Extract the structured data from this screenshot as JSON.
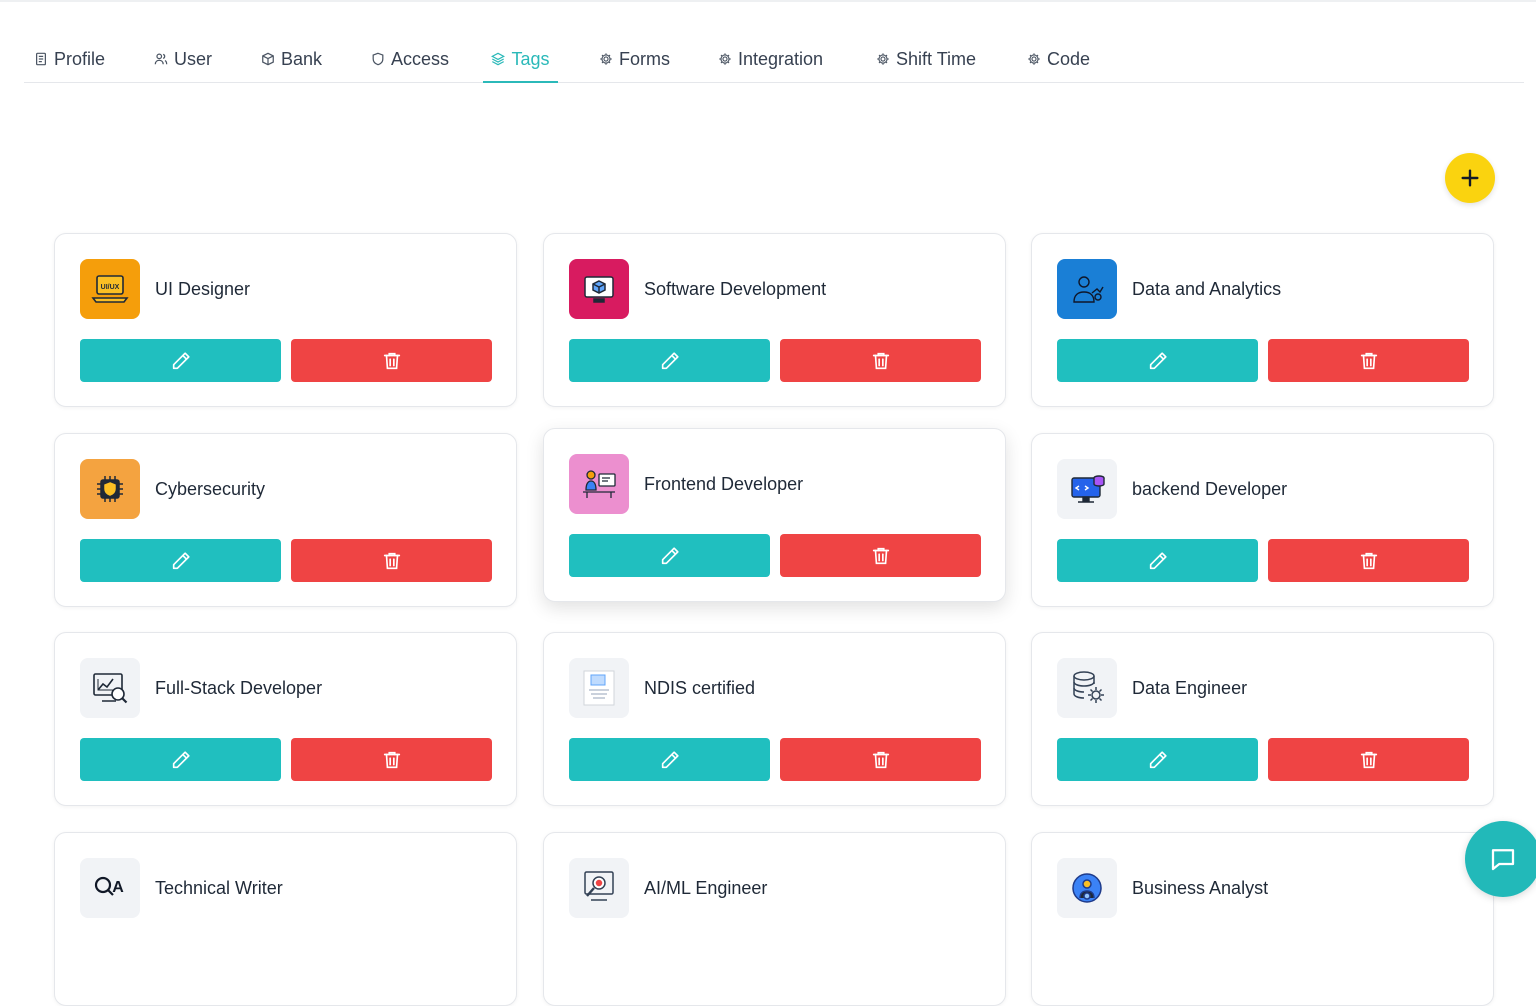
{
  "tabs": [
    {
      "label": "Profile",
      "icon": "id-card-icon"
    },
    {
      "label": "User",
      "icon": "users-icon"
    },
    {
      "label": "Bank",
      "icon": "box-icon"
    },
    {
      "label": "Access",
      "icon": "shield-icon"
    },
    {
      "label": "Tags",
      "icon": "layers-icon",
      "active": true
    },
    {
      "label": "Forms",
      "icon": "gear-icon"
    },
    {
      "label": "Integration",
      "icon": "gear-icon"
    },
    {
      "label": "Shift Time",
      "icon": "gear-icon"
    },
    {
      "label": "Code",
      "icon": "gear-icon"
    }
  ],
  "add_button_icon": "plus-icon",
  "colors": {
    "accent": "#2bb9b9",
    "edit": "#20bfbf",
    "delete": "#ef4444",
    "add": "#fad30f"
  },
  "tags": [
    {
      "title": "UI Designer",
      "icon": "ui-ux-laptop-icon",
      "bg": "#f59e0b"
    },
    {
      "title": "Software Development",
      "icon": "monitor-cube-icon",
      "bg": "#d81b60"
    },
    {
      "title": "Data and Analytics",
      "icon": "analyst-person-icon",
      "bg": "#1a7fd6"
    },
    {
      "title": "Cybersecurity",
      "icon": "chip-shield-icon",
      "bg": "#f4a340"
    },
    {
      "title": "Frontend Developer",
      "icon": "developer-desk-icon",
      "bg": "#ec8fcf"
    },
    {
      "title": "backend Developer",
      "icon": "code-monitor-icon",
      "bg": "#f1f3f6"
    },
    {
      "title": "Full-Stack Developer",
      "icon": "dashboard-search-icon",
      "bg": "#f1f3f6"
    },
    {
      "title": "NDIS certified",
      "icon": "certificate-icon",
      "bg": "#f1f3f6"
    },
    {
      "title": "Data Engineer",
      "icon": "database-gear-icon",
      "bg": "#f1f3f6"
    },
    {
      "title": "Technical Writer",
      "icon": "qa-magnifier-icon",
      "bg": "#f1f3f6"
    },
    {
      "title": "AI/ML Engineer",
      "icon": "bug-monitor-icon",
      "bg": "#f1f3f6"
    },
    {
      "title": "Business Analyst",
      "icon": "gear-person-icon",
      "bg": "#f1f3f6"
    }
  ],
  "chat_icon": "chat-bubble-icon"
}
